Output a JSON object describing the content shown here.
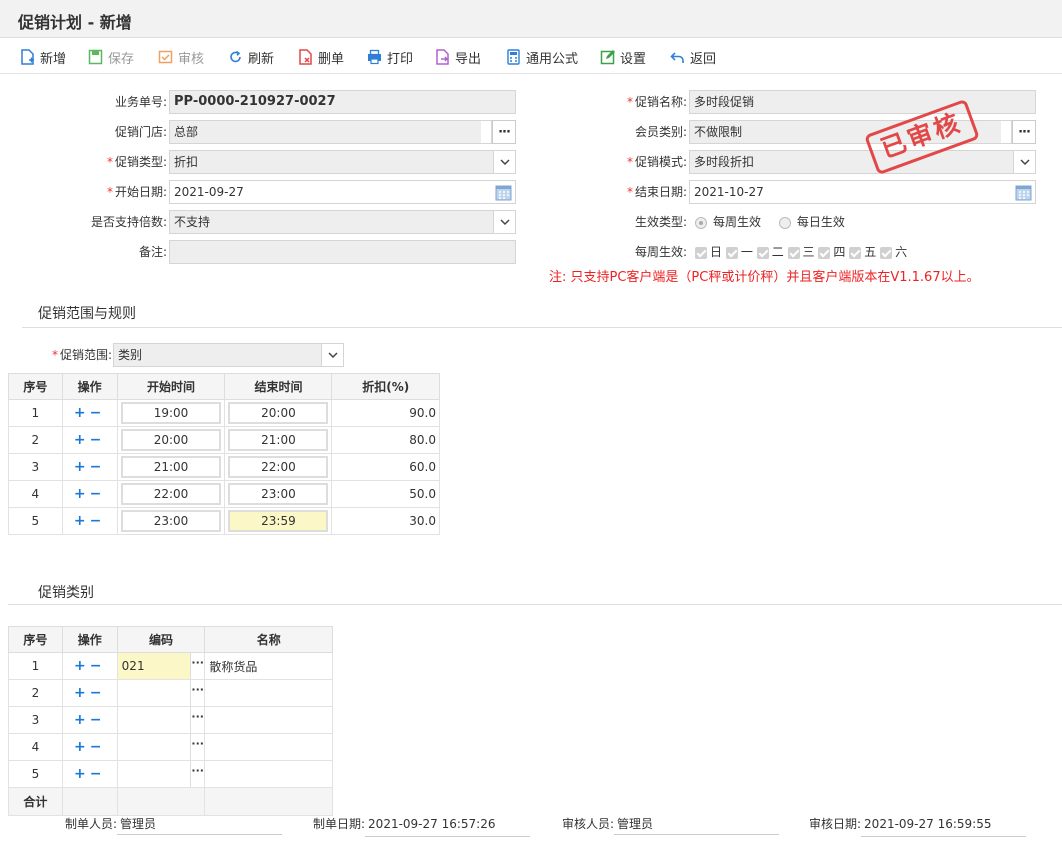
{
  "title": "促销计划 - 新增",
  "toolbar": {
    "new": "新增",
    "save": "保存",
    "audit": "审核",
    "refresh": "刷新",
    "delete": "删单",
    "print": "打印",
    "export": "导出",
    "formula": "通用公式",
    "settings": "设置",
    "back": "返回"
  },
  "form": {
    "doc_no_label": "业务单号:",
    "doc_no": "PP-0000-210927-0027",
    "store_label": "促销门店:",
    "store": "总部",
    "type_label": "促销类型:",
    "type": "折扣",
    "start_label": "开始日期:",
    "start": "2021-09-27",
    "multiple_label": "是否支持倍数:",
    "multiple": "不支持",
    "remark_label": "备注:",
    "remark": "",
    "name_label": "促销名称:",
    "name": "多时段促销",
    "member_label": "会员类别:",
    "member": "不做限制",
    "mode_label": "促销模式:",
    "mode": "多时段折扣",
    "end_label": "结束日期:",
    "end": "2021-10-27",
    "effect_label": "生效类型:",
    "effect_weekly": "每周生效",
    "effect_daily": "每日生效",
    "weekly_label": "每周生效:",
    "days": [
      "日",
      "一",
      "二",
      "三",
      "四",
      "五",
      "六"
    ]
  },
  "stamp": "已审核",
  "note": "注: 只支持PC客户端是（PC秤或计价秤）并且客户端版本在V1.1.67以上。",
  "scope_section": "促销范围与规则",
  "scope_label": "促销范围:",
  "scope_value": "类别",
  "rules": {
    "headers": [
      "序号",
      "操作",
      "开始时间",
      "结束时间",
      "折扣(%)"
    ],
    "rows": [
      {
        "no": "1",
        "start": "19:00",
        "end": "20:00",
        "disc": "90.0"
      },
      {
        "no": "2",
        "start": "20:00",
        "end": "21:00",
        "disc": "80.0"
      },
      {
        "no": "3",
        "start": "21:00",
        "end": "22:00",
        "disc": "60.0"
      },
      {
        "no": "4",
        "start": "22:00",
        "end": "23:00",
        "disc": "50.0"
      },
      {
        "no": "5",
        "start": "23:00",
        "end": "23:59",
        "disc": "30.0"
      }
    ]
  },
  "category_section": "促销类别",
  "cats": {
    "headers": [
      "序号",
      "操作",
      "编码",
      "名称"
    ],
    "rows": [
      {
        "no": "1",
        "code": "021",
        "name": "散称货品"
      },
      {
        "no": "2",
        "code": "",
        "name": ""
      },
      {
        "no": "3",
        "code": "",
        "name": ""
      },
      {
        "no": "4",
        "code": "",
        "name": ""
      },
      {
        "no": "5",
        "code": "",
        "name": ""
      }
    ],
    "total": "合计"
  },
  "footer": {
    "maker_label": "制单人员:",
    "maker": "管理员",
    "make_date_label": "制单日期:",
    "make_date": "2021-09-27 16:57:26",
    "auditor_label": "审核人员:",
    "auditor": "管理员",
    "audit_date_label": "审核日期:",
    "audit_date": "2021-09-27 16:59:55"
  },
  "colors": {
    "accent": "#1a78d8",
    "stamp": "#e23a3a",
    "note": "#e22222"
  }
}
